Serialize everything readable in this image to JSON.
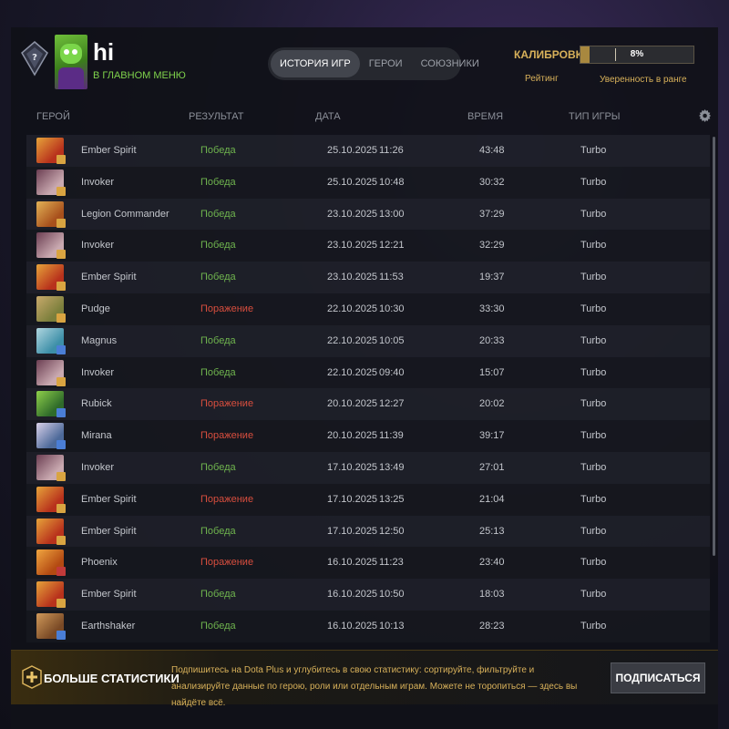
{
  "header": {
    "player_name": "hi",
    "player_status": "В ГЛАВНОМ МЕНЮ",
    "tabs": [
      {
        "label": "ИСТОРИЯ ИГР",
        "active": true
      },
      {
        "label": "ГЕРОИ",
        "active": false
      },
      {
        "label": "СОЮЗНИКИ",
        "active": false
      }
    ],
    "calibration_label": "КАЛИБРОВКА",
    "calibration_percent": "8%",
    "calibration_value": 0.08,
    "rating_label": "Рейтинг",
    "confidence_label": "Уверенность в ранге"
  },
  "columns": {
    "hero": "ГЕРОЙ",
    "result": "РЕЗУЛЬТАТ",
    "date": "ДАТА",
    "duration": "ВРЕМЯ",
    "mode": "ТИП ИГРЫ"
  },
  "matches": [
    {
      "hero": "Ember Spirit",
      "result": "Победа",
      "outcome": "win",
      "date": "25.10.2025",
      "time": "11:26",
      "duration": "43:48",
      "mode": "Turbo"
    },
    {
      "hero": "Invoker",
      "result": "Победа",
      "outcome": "win",
      "date": "25.10.2025",
      "time": "10:48",
      "duration": "30:32",
      "mode": "Turbo"
    },
    {
      "hero": "Legion Commander",
      "result": "Победа",
      "outcome": "win",
      "date": "23.10.2025",
      "time": "13:00",
      "duration": "37:29",
      "mode": "Turbo"
    },
    {
      "hero": "Invoker",
      "result": "Победа",
      "outcome": "win",
      "date": "23.10.2025",
      "time": "12:21",
      "duration": "32:29",
      "mode": "Turbo"
    },
    {
      "hero": "Ember Spirit",
      "result": "Победа",
      "outcome": "win",
      "date": "23.10.2025",
      "time": "11:53",
      "duration": "19:37",
      "mode": "Turbo"
    },
    {
      "hero": "Pudge",
      "result": "Поражение",
      "outcome": "loss",
      "date": "22.10.2025",
      "time": "10:30",
      "duration": "33:30",
      "mode": "Turbo"
    },
    {
      "hero": "Magnus",
      "result": "Победа",
      "outcome": "win",
      "date": "22.10.2025",
      "time": "10:05",
      "duration": "20:33",
      "mode": "Turbo"
    },
    {
      "hero": "Invoker",
      "result": "Победа",
      "outcome": "win",
      "date": "22.10.2025",
      "time": "09:40",
      "duration": "15:07",
      "mode": "Turbo"
    },
    {
      "hero": "Rubick",
      "result": "Поражение",
      "outcome": "loss",
      "date": "20.10.2025",
      "time": "12:27",
      "duration": "20:02",
      "mode": "Turbo"
    },
    {
      "hero": "Mirana",
      "result": "Поражение",
      "outcome": "loss",
      "date": "20.10.2025",
      "time": "11:39",
      "duration": "39:17",
      "mode": "Turbo"
    },
    {
      "hero": "Invoker",
      "result": "Победа",
      "outcome": "win",
      "date": "17.10.2025",
      "time": "13:49",
      "duration": "27:01",
      "mode": "Turbo"
    },
    {
      "hero": "Ember Spirit",
      "result": "Поражение",
      "outcome": "loss",
      "date": "17.10.2025",
      "time": "13:25",
      "duration": "21:04",
      "mode": "Turbo"
    },
    {
      "hero": "Ember Spirit",
      "result": "Победа",
      "outcome": "win",
      "date": "17.10.2025",
      "time": "12:50",
      "duration": "25:13",
      "mode": "Turbo"
    },
    {
      "hero": "Phoenix",
      "result": "Поражение",
      "outcome": "loss",
      "date": "16.10.2025",
      "time": "11:23",
      "duration": "23:40",
      "mode": "Turbo"
    },
    {
      "hero": "Ember Spirit",
      "result": "Победа",
      "outcome": "win",
      "date": "16.10.2025",
      "time": "10:50",
      "duration": "18:03",
      "mode": "Turbo"
    },
    {
      "hero": "Earthshaker",
      "result": "Победа",
      "outcome": "win",
      "date": "16.10.2025",
      "time": "10:13",
      "duration": "28:23",
      "mode": "Turbo"
    }
  ],
  "hero_colors": {
    "Ember Spirit": [
      "#b8321c",
      "#e6a33a",
      "#d9a441"
    ],
    "Invoker": [
      "#c9a9b0",
      "#6b3e52",
      "#d9a441"
    ],
    "Legion Commander": [
      "#a8501c",
      "#e2b256",
      "#d9a441"
    ],
    "Pudge": [
      "#7b7f3c",
      "#c9a96b",
      "#d9a441"
    ],
    "Magnus": [
      "#3d8fa8",
      "#b0d6df",
      "#4a7ed6"
    ],
    "Rubick": [
      "#2f6b2a",
      "#8fd04a",
      "#4a7ed6"
    ],
    "Mirana": [
      "#4d6a9a",
      "#d8d0e8",
      "#4a7ed6"
    ],
    "Phoenix": [
      "#b34a12",
      "#f0a640",
      "#c23a3a"
    ],
    "Earthshaker": [
      "#7a4a26",
      "#d09a5a",
      "#4a7ed6"
    ]
  },
  "footer": {
    "title": "БОЛЬШЕ СТАТИСТИКИ",
    "text": "Подпишитесь на Dota Plus и углубитесь в свою статистику: сортируйте, фильтруйте и анализируйте данные по герою, роли или отдельным играм. Можете не торопиться — здесь вы найдёте всё.",
    "subscribe_label": "ПОДПИСАТЬСЯ"
  },
  "colors": {
    "win": "#6fb44e",
    "loss": "#d84e3e",
    "accent_gold": "#d8b15a",
    "status_green": "#7fd34c"
  },
  "icons": [
    "rank-badge-icon",
    "settings-gear-icon",
    "dota-plus-icon"
  ]
}
